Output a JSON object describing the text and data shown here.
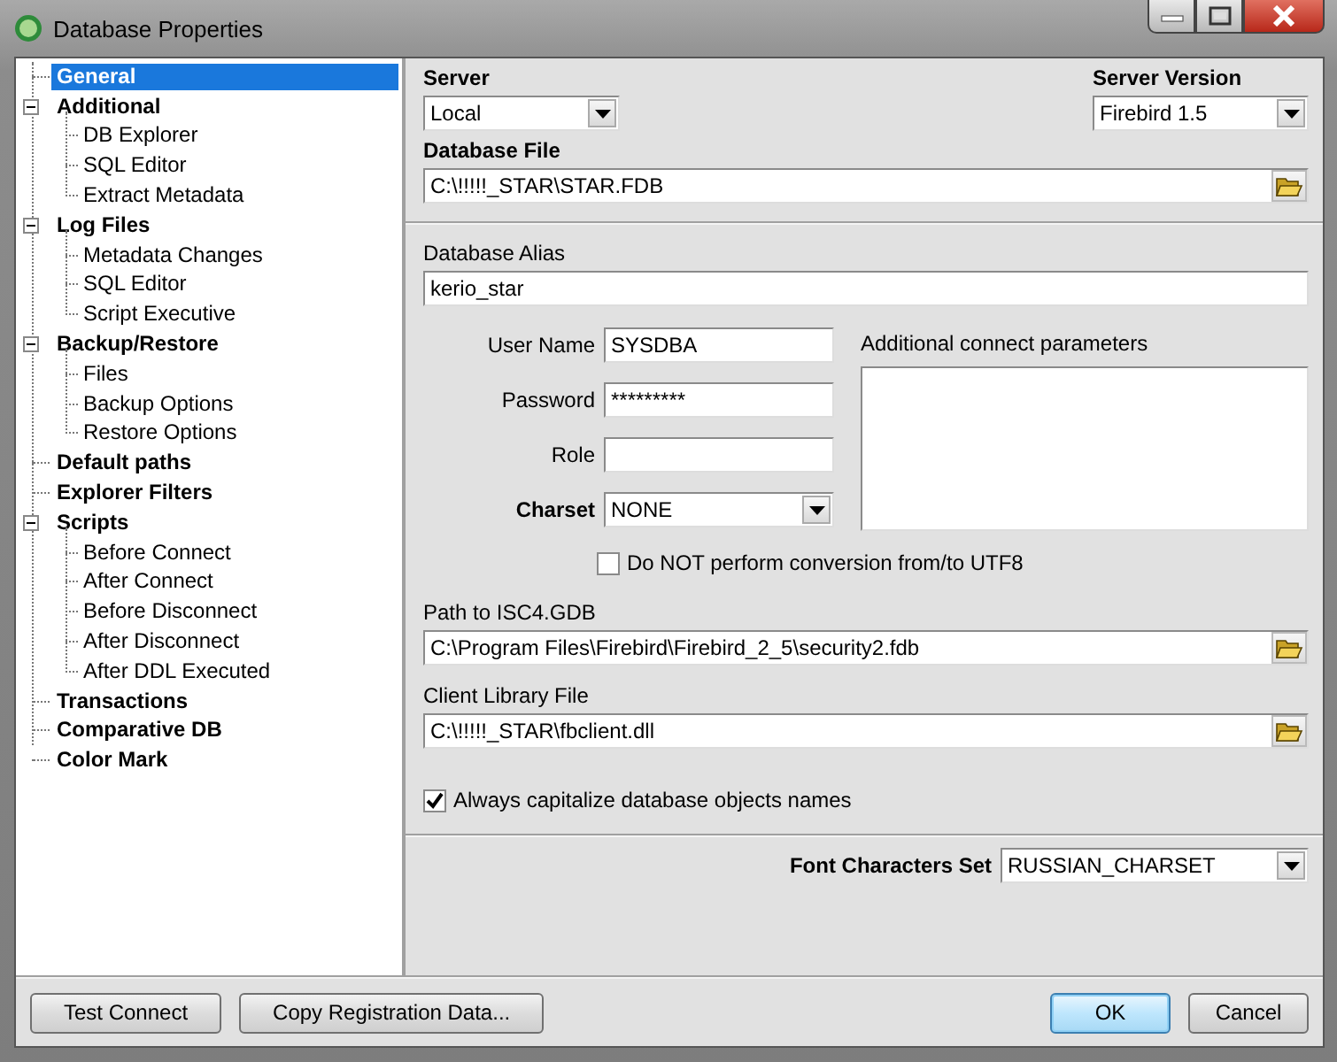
{
  "window": {
    "title": "Database Properties"
  },
  "tree": [
    {
      "label": "General",
      "selected": true
    },
    {
      "label": "Additional",
      "selected": false,
      "expanded": true,
      "children": [
        {
          "label": "DB Explorer",
          "selected": false
        },
        {
          "label": "SQL Editor",
          "selected": false
        },
        {
          "label": "Extract Metadata",
          "selected": false
        }
      ]
    },
    {
      "label": "Log Files",
      "selected": false,
      "expanded": true,
      "children": [
        {
          "label": "Metadata Changes",
          "selected": false
        },
        {
          "label": "SQL Editor",
          "selected": false
        },
        {
          "label": "Script Executive",
          "selected": false
        }
      ]
    },
    {
      "label": "Backup/Restore",
      "selected": false,
      "expanded": true,
      "children": [
        {
          "label": "Files",
          "selected": false
        },
        {
          "label": "Backup Options",
          "selected": false
        },
        {
          "label": "Restore Options",
          "selected": false
        }
      ]
    },
    {
      "label": "Default paths",
      "selected": false
    },
    {
      "label": "Explorer Filters",
      "selected": false
    },
    {
      "label": "Scripts",
      "selected": false,
      "expanded": true,
      "children": [
        {
          "label": "Before Connect",
          "selected": false
        },
        {
          "label": "After Connect",
          "selected": false
        },
        {
          "label": "Before Disconnect",
          "selected": false
        },
        {
          "label": "After Disconnect",
          "selected": false
        },
        {
          "label": "After DDL Executed",
          "selected": false
        }
      ]
    },
    {
      "label": "Transactions",
      "selected": false
    },
    {
      "label": "Comparative DB",
      "selected": false
    },
    {
      "label": "Color Mark",
      "selected": false
    }
  ],
  "server": {
    "label": "Server",
    "value": "Local"
  },
  "server_version": {
    "label": "Server Version",
    "value": "Firebird 1.5"
  },
  "database_file": {
    "label": "Database File",
    "value": "C:\\!!!!!_STAR\\STAR.FDB"
  },
  "database_alias": {
    "label": "Database Alias",
    "value": "kerio_star"
  },
  "credentials": [
    {
      "kind": "text",
      "label": "User Name",
      "value": "SYSDBA"
    },
    {
      "kind": "password",
      "label": "Password",
      "value": "*********"
    },
    {
      "kind": "text",
      "label": "Role"
    },
    {
      "kind": "combo",
      "label": "Charset",
      "value": "NONE"
    }
  ],
  "additional_params": {
    "label": "Additional connect parameters"
  },
  "utf8_option": {
    "label": "Do NOT perform conversion from/to UTF8",
    "checked": false
  },
  "isc4_path": {
    "label": "Path to ISC4.GDB",
    "value": "C:\\Program Files\\Firebird\\Firebird_2_5\\security2.fdb"
  },
  "client_library": {
    "label": "Client Library File",
    "value": "C:\\!!!!!_STAR\\fbclient.dll"
  },
  "capitalize_option": {
    "label": "Always capitalize database objects names",
    "checked": true
  },
  "font_charset": {
    "label": "Font Characters Set",
    "value": "RUSSIAN_CHARSET"
  },
  "buttons": [
    {
      "label": "Test Connect",
      "kind": "left"
    },
    {
      "label": "Copy Registration Data...",
      "kind": "left"
    },
    {
      "label": "OK",
      "kind": "default"
    },
    {
      "label": "Cancel",
      "kind": "right"
    }
  ]
}
